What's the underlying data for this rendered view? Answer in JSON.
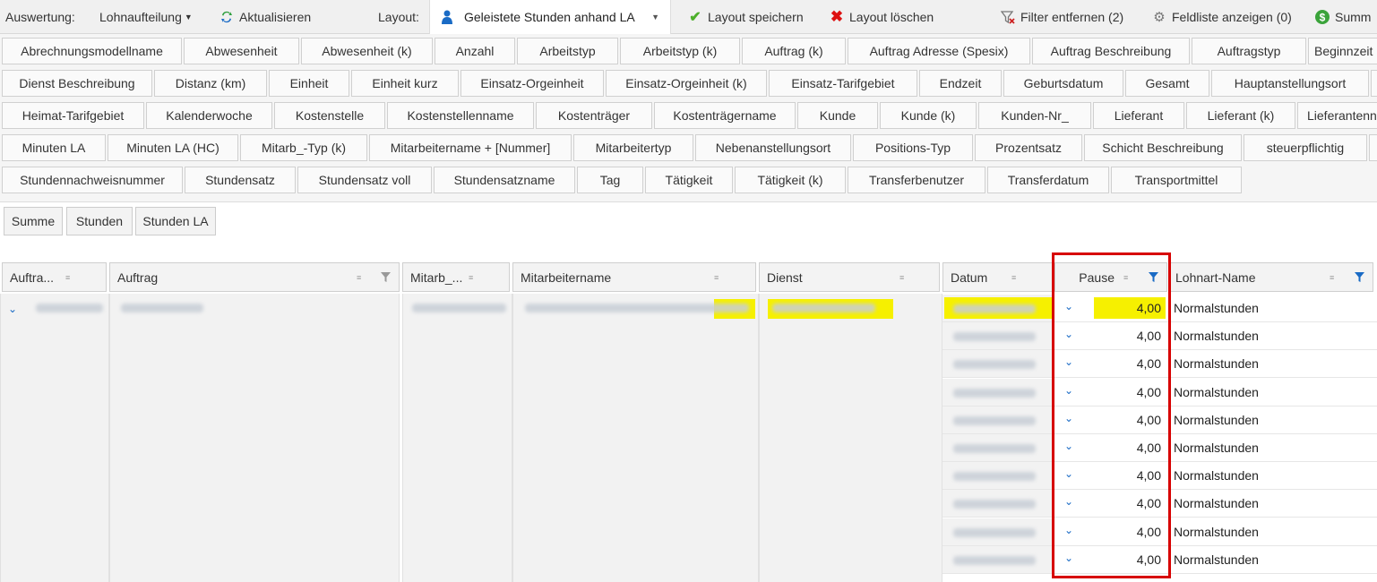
{
  "toolbar": {
    "auswertung_label": "Auswertung:",
    "report_dropdown": "Lohnaufteilung",
    "refresh": "Aktualisieren",
    "layout_label": "Layout:",
    "layout_value": "Geleistete Stunden anhand LA",
    "save_layout": "Layout speichern",
    "delete_layout": "Layout löschen",
    "remove_filter": "Filter entfernen (2)",
    "field_list": "Feldliste anzeigen (0)",
    "summary": "Summ"
  },
  "field_rows": [
    [
      "Abrechnungsmodellname",
      "Abwesenheit",
      "Abwesenheit (k)",
      "Anzahl",
      "Arbeitstyp",
      "Arbeitstyp (k)",
      "Auftrag (k)",
      "Auftrag Adresse (Spesix)",
      "Auftrag Beschreibung",
      "Auftragstyp",
      "Beginnzeit"
    ],
    [
      "Dienst Beschreibung",
      "Distanz (km)",
      "Einheit",
      "Einheit kurz",
      "Einsatz-Orgeinheit",
      "Einsatz-Orgeinheit (k)",
      "Einsatz-Tarifgebiet",
      "Endzeit",
      "Geburtsdatum",
      "Gesamt",
      "Hauptanstellungsort"
    ],
    [
      "Heimat-Tarifgebiet",
      "Kalenderwoche",
      "Kostenstelle",
      "Kostenstellenname",
      "Kostenträger",
      "Kostenträgername",
      "Kunde",
      "Kunde (k)",
      "Kunden-Nr_",
      "Lieferant",
      "Lieferant (k)",
      "Lieferantenn"
    ],
    [
      "Minuten LA",
      "Minuten LA (HC)",
      "Mitarb_-Typ (k)",
      "Mitarbeitername + [Nummer]",
      "Mitarbeitertyp",
      "Nebenanstellungsort",
      "Positions-Typ",
      "Prozentsatz",
      "Schicht Beschreibung",
      "steuerpflichtig"
    ],
    [
      "Stundennachweisnummer",
      "Stundensatz",
      "Stundensatz voll",
      "Stundensatzname",
      "Tag",
      "Tätigkeit",
      "Tätigkeit (k)",
      "Transferbenutzer",
      "Transferdatum",
      "Transportmittel"
    ]
  ],
  "data_fields": [
    "Summe",
    "Stunden",
    "Stunden LA"
  ],
  "columns": {
    "auftrag_nr": "Auftra...",
    "auftrag": "Auftrag",
    "mitarb_nr": "Mitarb_...",
    "mitarbeitername": "Mitarbeitername",
    "dienst": "Dienst",
    "datum": "Datum",
    "pause": "Pause",
    "lohnart": "Lohnart-Name"
  },
  "rows": [
    {
      "pause": "4,00",
      "lohnart": "Normalstunden"
    },
    {
      "pause": "4,00",
      "lohnart": "Normalstunden"
    },
    {
      "pause": "4,00",
      "lohnart": "Normalstunden"
    },
    {
      "pause": "4,00",
      "lohnart": "Normalstunden"
    },
    {
      "pause": "4,00",
      "lohnart": "Normalstunden"
    },
    {
      "pause": "4,00",
      "lohnart": "Normalstunden"
    },
    {
      "pause": "4,00",
      "lohnart": "Normalstunden"
    },
    {
      "pause": "4,00",
      "lohnart": "Normalstunden"
    },
    {
      "pause": "4,00",
      "lohnart": "Normalstunden"
    },
    {
      "pause": "4,00",
      "lohnart": "Normalstunden"
    }
  ],
  "colors": {
    "highlight": "#f6f000",
    "accent": "#1a6bc5",
    "annotation": "#d70000"
  }
}
